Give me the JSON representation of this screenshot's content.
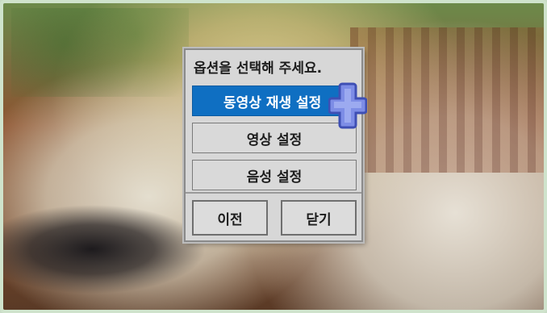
{
  "dialog": {
    "title": "옵션을 선택해 주세요.",
    "items": [
      {
        "label": "동영상 재생 설정",
        "selected": true
      },
      {
        "label": "영상 설정",
        "selected": false
      },
      {
        "label": "음성 설정",
        "selected": false
      }
    ],
    "buttons": {
      "prev": "이전",
      "close": "닫기"
    }
  },
  "colors": {
    "selected_bg": "#0f6fc2",
    "dialog_bg": "#d7d7d7",
    "cursor": "#5d6fd6"
  },
  "cursor": {
    "icon": "plus-cursor-icon"
  }
}
